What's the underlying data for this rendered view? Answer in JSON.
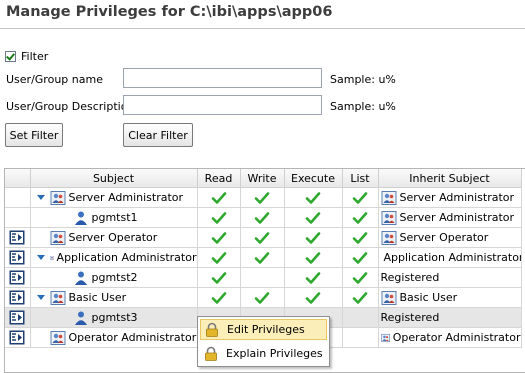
{
  "header": {
    "title": "Manage Privileges for C:\\ibi\\apps\\app06"
  },
  "filter": {
    "checkbox_label": "Filter",
    "checked": true,
    "user_group_name_label": "User/Group name",
    "user_group_name_value": "",
    "user_group_description_label": "User/Group Description",
    "user_group_description_value": "",
    "sample_name": "Sample: u%",
    "sample_description": "Sample: u%",
    "set_filter_label": "Set Filter",
    "clear_filter_label": "Clear Filter"
  },
  "grid": {
    "columns": {
      "subject": "Subject",
      "read": "Read",
      "write": "Write",
      "execute": "Execute",
      "list": "List",
      "inherit": "Inherit Subject"
    },
    "rows": [
      {
        "subject": "Server Administrator",
        "indent": 0,
        "expanded": true,
        "type": "group",
        "has_props_icon": false,
        "read": true,
        "write": true,
        "execute": true,
        "list": true,
        "inherit": "Server Administrator",
        "inherit_icon": true
      },
      {
        "subject": "pgmtst1",
        "indent": 1,
        "expanded": false,
        "type": "user",
        "has_props_icon": false,
        "read": true,
        "write": true,
        "execute": true,
        "list": true,
        "inherit": "Server Administrator",
        "inherit_icon": true
      },
      {
        "subject": "Server Operator",
        "indent": 0,
        "expanded": false,
        "type": "group",
        "has_props_icon": true,
        "read": true,
        "write": true,
        "execute": true,
        "list": true,
        "inherit": "Server Operator",
        "inherit_icon": true
      },
      {
        "subject": "Application Administrator",
        "indent": 0,
        "expanded": true,
        "type": "group",
        "has_props_icon": true,
        "read": true,
        "write": true,
        "execute": true,
        "list": true,
        "inherit": "Application Administrator",
        "inherit_icon": true
      },
      {
        "subject": "pgmtst2",
        "indent": 1,
        "expanded": false,
        "type": "user",
        "has_props_icon": true,
        "read": true,
        "write": false,
        "execute": true,
        "list": true,
        "inherit": "Registered",
        "inherit_icon": false
      },
      {
        "subject": "Basic User",
        "indent": 0,
        "expanded": true,
        "type": "group",
        "has_props_icon": true,
        "read": true,
        "write": true,
        "execute": true,
        "list": true,
        "inherit": "Basic User",
        "inherit_icon": true
      },
      {
        "subject": "pgmtst3",
        "indent": 1,
        "expanded": false,
        "type": "user",
        "has_props_icon": true,
        "selected": true,
        "read": false,
        "write": false,
        "execute": false,
        "list": false,
        "inherit": "Registered",
        "inherit_icon": false
      },
      {
        "subject": "Operator Administrator",
        "indent": 0,
        "expanded": false,
        "type": "group",
        "has_props_icon": true,
        "read": false,
        "write": false,
        "execute": false,
        "list": false,
        "inherit": "Operator Administrator",
        "inherit_icon": true
      }
    ]
  },
  "context_menu": {
    "items": [
      {
        "label": "Edit Privileges",
        "icon": "lock-icon",
        "highlighted": true
      },
      {
        "label": "Explain Privileges",
        "icon": "lock-icon",
        "highlighted": false
      }
    ]
  },
  "colors": {
    "check": "#2fa82f",
    "accent": "#2a6fb5",
    "menu_highlight": "#fbeeb8"
  }
}
